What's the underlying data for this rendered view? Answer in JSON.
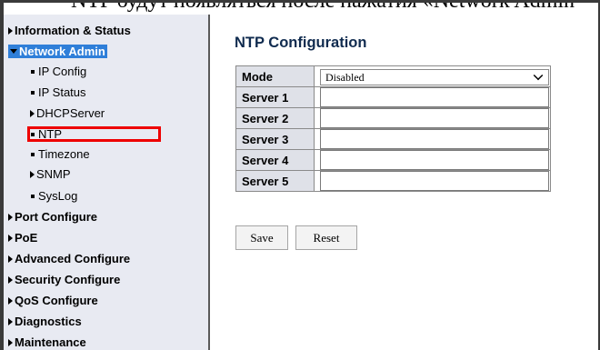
{
  "background_text": "NTP будут появляться после нажатия «Network Admin",
  "sidebar": {
    "items": [
      {
        "label": "Information & Status"
      },
      {
        "label": "Network Admin"
      },
      {
        "label": "IP Config"
      },
      {
        "label": "IP Status"
      },
      {
        "label": "DHCPServer"
      },
      {
        "label": "NTP"
      },
      {
        "label": "Timezone"
      },
      {
        "label": "SNMP"
      },
      {
        "label": "SysLog"
      },
      {
        "label": "Port Configure"
      },
      {
        "label": "PoE"
      },
      {
        "label": "Advanced Configure"
      },
      {
        "label": "Security Configure"
      },
      {
        "label": "QoS Configure"
      },
      {
        "label": "Diagnostics"
      },
      {
        "label": "Maintenance"
      }
    ]
  },
  "main": {
    "title": "NTP Configuration",
    "mode": {
      "label": "Mode",
      "value": "Disabled"
    },
    "servers": [
      {
        "label": "Server 1",
        "value": ""
      },
      {
        "label": "Server 2",
        "value": ""
      },
      {
        "label": "Server 3",
        "value": ""
      },
      {
        "label": "Server 4",
        "value": ""
      },
      {
        "label": "Server 5",
        "value": ""
      }
    ],
    "save_label": "Save",
    "reset_label": "Reset"
  },
  "colors": {
    "selected_bg": "#2f7fd9",
    "highlight": "#ee0000",
    "title": "#102b4f",
    "sidebar_bg": "#e8eaf2"
  }
}
